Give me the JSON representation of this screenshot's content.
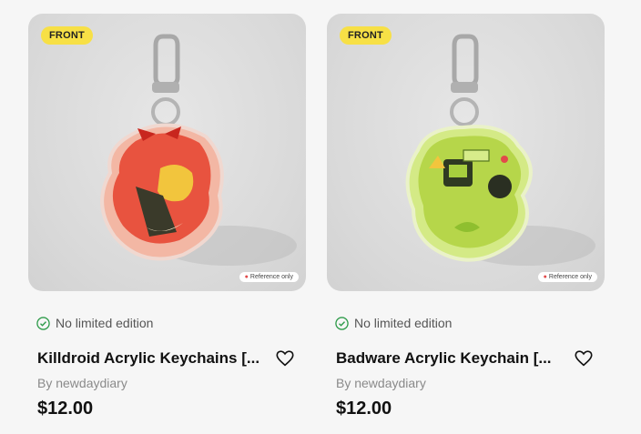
{
  "products": [
    {
      "badge": "FRONT",
      "reference_label": "Reference only",
      "edition": "No limited edition",
      "title": "Killdroid Acrylic Keychains [...",
      "seller": "By newdaydiary",
      "price": "$12.00",
      "accent_color": "#e8533f"
    },
    {
      "badge": "FRONT",
      "reference_label": "Reference only",
      "edition": "No limited edition",
      "title": "Badware Acrylic Keychain [...",
      "seller": "By newdaydiary",
      "price": "$12.00",
      "accent_color": "#b6d64a"
    }
  ],
  "colors": {
    "badge_bg": "#f7e046",
    "check_green": "#2e9b4a"
  }
}
